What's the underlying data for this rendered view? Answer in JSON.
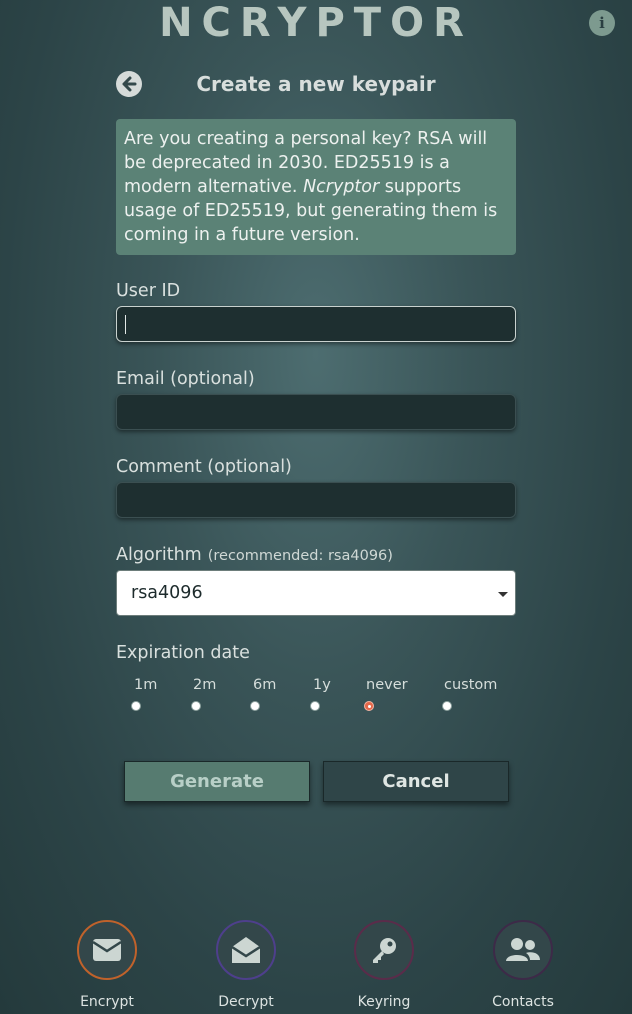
{
  "app": {
    "title": "NCRYPTOR"
  },
  "header": {
    "info_icon": "info-icon",
    "back_icon": "arrow-left-circle-icon",
    "page_title": "Create a new keypair"
  },
  "notice": {
    "text_before": "Are you creating a personal key? RSA will be deprecated in 2030. ED25519 is a modern alternative. ",
    "emphasis": "Ncryptor",
    "text_after": " supports usage of ED25519, but generating them is coming in a future version."
  },
  "form": {
    "user_id": {
      "label": "User ID",
      "value": ""
    },
    "email": {
      "label": "Email (optional)",
      "value": ""
    },
    "comment": {
      "label": "Comment (optional)",
      "value": ""
    },
    "algorithm": {
      "label": "Algorithm",
      "note": "(recommended: rsa4096)",
      "selected": "rsa4096"
    },
    "expiration": {
      "label": "Expiration date",
      "options": [
        "1m",
        "2m",
        "6m",
        "1y",
        "never",
        "custom"
      ],
      "selected": "never"
    }
  },
  "actions": {
    "generate_label": "Generate",
    "cancel_label": "Cancel"
  },
  "nav": {
    "items": [
      {
        "label": "Encrypt",
        "icon": "envelope-icon",
        "ring_color": "#c0622b"
      },
      {
        "label": "Decrypt",
        "icon": "envelope-open-icon",
        "ring_color": "#4e3f8c"
      },
      {
        "label": "Keyring",
        "icon": "key-icon",
        "ring_color": "#5a2c4a"
      },
      {
        "label": "Contacts",
        "icon": "users-icon",
        "ring_color": "#3d2a48"
      }
    ]
  },
  "colors": {
    "accent": "#5b8276",
    "radio_selected": "#e4684a",
    "background": "#3a5558"
  }
}
